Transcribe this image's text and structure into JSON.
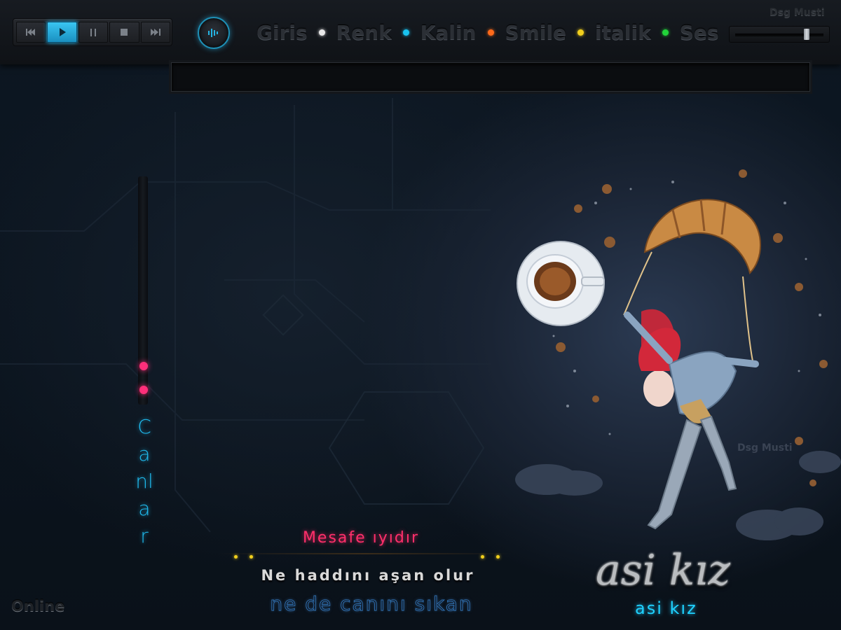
{
  "player": {
    "buttons": [
      {
        "id": "previous",
        "icon": "skip-previous-icon",
        "active": false
      },
      {
        "id": "play",
        "icon": "play-icon",
        "active": true
      },
      {
        "id": "pause",
        "icon": "pause-icon",
        "active": false
      },
      {
        "id": "stop",
        "icon": "stop-icon",
        "active": false
      },
      {
        "id": "next",
        "icon": "skip-next-icon",
        "active": false
      }
    ],
    "volume_level": 0.82,
    "accent_color": "#1fb6ec"
  },
  "menu": {
    "items": [
      {
        "label": "Giris",
        "dot_color": "#e8e8e8"
      },
      {
        "label": "Renk",
        "dot_color": "#19c3f0"
      },
      {
        "label": "Kalin",
        "dot_color": "#ff6a1a"
      },
      {
        "label": "Smile",
        "dot_color": "#f1cf1d"
      },
      {
        "label": "italik",
        "dot_color": "#22d43a"
      },
      {
        "label": "Ses",
        "dot_color": null
      }
    ]
  },
  "brand": {
    "top": "Dsg Musti",
    "watermark": "Dsg Musti"
  },
  "textbar": {
    "value": ""
  },
  "sidebar": {
    "label": "Canlar",
    "dot_color": "#ff2f7a"
  },
  "status": {
    "online": "Online"
  },
  "lyrics": {
    "line1": "Mesafe ıyıdır",
    "line2": "Ne haddını aşan olur",
    "line3": "ne de canını sıkan"
  },
  "artwork": {
    "title": "asi kız",
    "subtitle": "asi kız"
  }
}
